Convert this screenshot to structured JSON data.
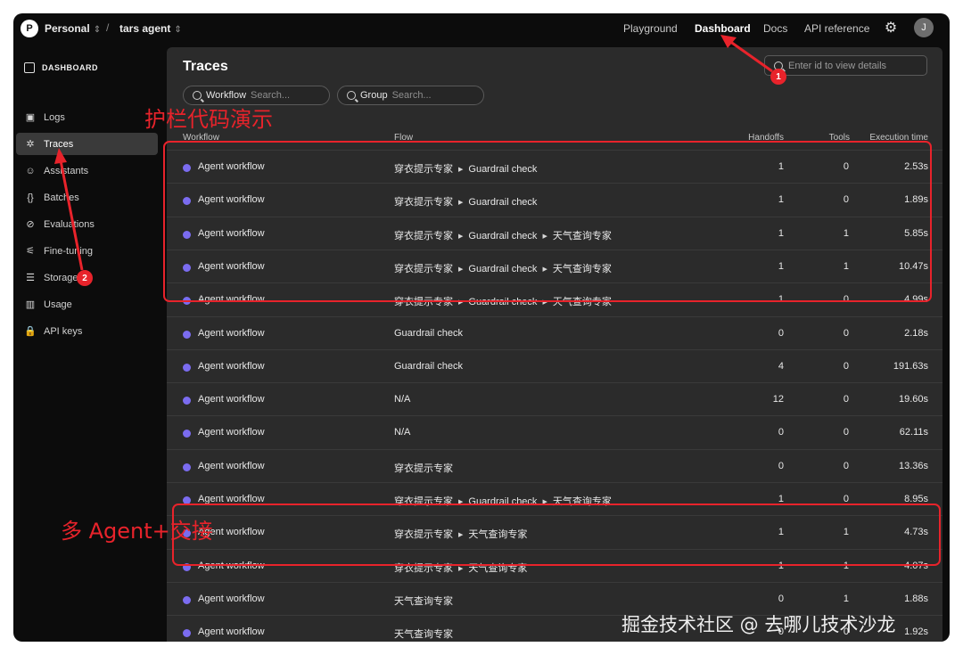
{
  "topbar": {
    "org_initial": "P",
    "org_name": "Personal",
    "separator": "/",
    "project_name": "tars agent",
    "nav": [
      "Playground",
      "Dashboard",
      "Docs",
      "API reference"
    ],
    "active_nav": "Dashboard",
    "avatar_initial": "J"
  },
  "sidebar": {
    "section_label": "DASHBOARD",
    "items": [
      {
        "label": "Logs",
        "icon": "terminal-icon",
        "glyph": "▣"
      },
      {
        "label": "Traces",
        "icon": "traces-icon",
        "glyph": "✲"
      },
      {
        "label": "Assistants",
        "icon": "robot-icon",
        "glyph": "☺"
      },
      {
        "label": "Batches",
        "icon": "braces-icon",
        "glyph": "{}"
      },
      {
        "label": "Evaluations",
        "icon": "compass-icon",
        "glyph": "⊘"
      },
      {
        "label": "Fine-tuning",
        "icon": "sliders-icon",
        "glyph": "⚟"
      },
      {
        "label": "Storage",
        "icon": "database-icon",
        "glyph": "☰"
      },
      {
        "label": "Usage",
        "icon": "bar-chart-icon",
        "glyph": "▥"
      },
      {
        "label": "API keys",
        "icon": "lock-icon",
        "glyph": "🔒"
      }
    ],
    "active_item": "Traces"
  },
  "main": {
    "title": "Traces",
    "id_search_placeholder": "Enter id to view details",
    "filters": [
      {
        "label": "Workflow",
        "placeholder": "Search..."
      },
      {
        "label": "Group",
        "placeholder": "Search..."
      }
    ],
    "columns": [
      "Workflow",
      "Flow",
      "Handoffs",
      "Tools",
      "Execution time"
    ],
    "rows": [
      {
        "workflow": "Agent workflow",
        "flow": [
          "穿衣提示专家",
          "Guardrail check"
        ],
        "handoffs": "1",
        "tools": "0",
        "time": "2.53s"
      },
      {
        "workflow": "Agent workflow",
        "flow": [
          "穿衣提示专家",
          "Guardrail check"
        ],
        "handoffs": "1",
        "tools": "0",
        "time": "1.89s"
      },
      {
        "workflow": "Agent workflow",
        "flow": [
          "穿衣提示专家",
          "Guardrail check",
          "天气查询专家"
        ],
        "handoffs": "1",
        "tools": "1",
        "time": "5.85s"
      },
      {
        "workflow": "Agent workflow",
        "flow": [
          "穿衣提示专家",
          "Guardrail check",
          "天气查询专家"
        ],
        "handoffs": "1",
        "tools": "1",
        "time": "10.47s"
      },
      {
        "workflow": "Agent workflow",
        "flow": [
          "穿衣提示专家",
          "Guardrail check",
          "天气查询专家"
        ],
        "handoffs": "1",
        "tools": "0",
        "time": "4.99s"
      },
      {
        "workflow": "Agent workflow",
        "flow": [
          "Guardrail check"
        ],
        "handoffs": "0",
        "tools": "0",
        "time": "2.18s"
      },
      {
        "workflow": "Agent workflow",
        "flow": [
          "Guardrail check"
        ],
        "handoffs": "4",
        "tools": "0",
        "time": "191.63s"
      },
      {
        "workflow": "Agent workflow",
        "flow": [
          "N/A"
        ],
        "handoffs": "12",
        "tools": "0",
        "time": "19.60s"
      },
      {
        "workflow": "Agent workflow",
        "flow": [
          "N/A"
        ],
        "handoffs": "0",
        "tools": "0",
        "time": "62.11s"
      },
      {
        "workflow": "Agent workflow",
        "flow": [
          "穿衣提示专家"
        ],
        "handoffs": "0",
        "tools": "0",
        "time": "13.36s"
      },
      {
        "workflow": "Agent workflow",
        "flow": [
          "穿衣提示专家",
          "Guardrail check",
          "天气查询专家"
        ],
        "handoffs": "1",
        "tools": "0",
        "time": "8.95s"
      },
      {
        "workflow": "Agent workflow",
        "flow": [
          "穿衣提示专家",
          "天气查询专家"
        ],
        "handoffs": "1",
        "tools": "1",
        "time": "4.73s"
      },
      {
        "workflow": "Agent workflow",
        "flow": [
          "穿衣提示专家",
          "天气查询专家"
        ],
        "handoffs": "1",
        "tools": "1",
        "time": "4.07s"
      },
      {
        "workflow": "Agent workflow",
        "flow": [
          "天气查询专家"
        ],
        "handoffs": "0",
        "tools": "1",
        "time": "1.88s"
      },
      {
        "workflow": "Agent workflow",
        "flow": [
          "天气查询专家"
        ],
        "handoffs": "0",
        "tools": "0",
        "time": "1.92s"
      }
    ],
    "dot_color": "#7b6cf0"
  },
  "annotations": {
    "color": "#e8232b",
    "guardrail_label": "护栏代码演示",
    "multi_agent_label": "多 Agent+交接",
    "badges": [
      "1",
      "2"
    ]
  },
  "watermark": "掘金技术社区 @ 去哪儿技术沙龙"
}
